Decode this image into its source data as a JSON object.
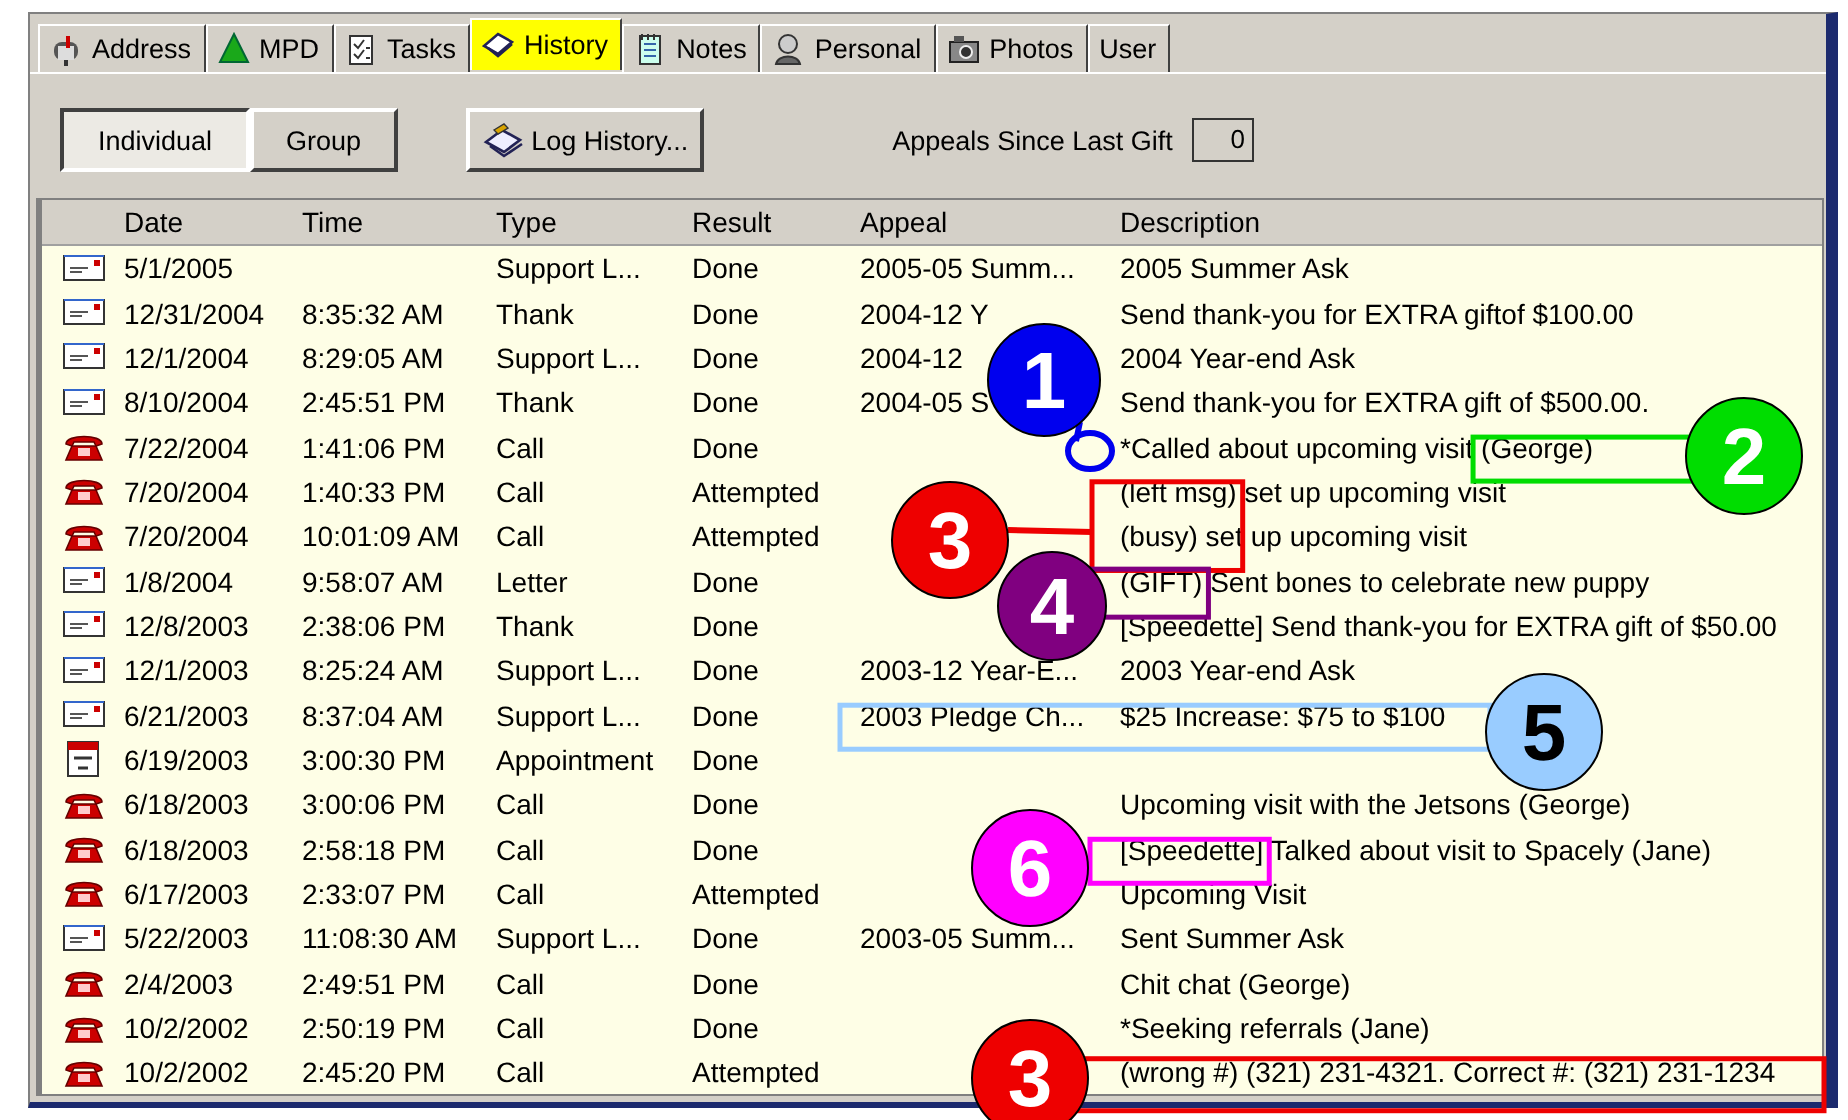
{
  "tabs": [
    {
      "label": "Address",
      "selected": false
    },
    {
      "label": "MPD",
      "selected": false
    },
    {
      "label": "Tasks",
      "selected": false
    },
    {
      "label": "History",
      "selected": true
    },
    {
      "label": "Notes",
      "selected": false
    },
    {
      "label": "Personal",
      "selected": false
    },
    {
      "label": "Photos",
      "selected": false
    },
    {
      "label": "User",
      "selected": false
    }
  ],
  "view_toggle": [
    {
      "label": "Individual",
      "selected": true
    },
    {
      "label": "Group",
      "selected": false
    }
  ],
  "log_button": {
    "label": "Log History..."
  },
  "appeals_since_last_gift": {
    "label": "Appeals Since Last Gift",
    "value": "0"
  },
  "table": {
    "columns": [
      "Date",
      "Time",
      "Type",
      "Result",
      "Appeal",
      "Description"
    ],
    "rows": [
      {
        "kind": "letter",
        "cells": [
          "5/1/2005",
          "",
          "Support L...",
          "Done",
          "2005-05 Summ...",
          "2005 Summer Ask"
        ]
      },
      {
        "kind": "letter",
        "cells": [
          "12/31/2004",
          "8:35:32 AM",
          "Thank",
          "Done",
          "2004-12 Y",
          "Send thank-you for EXTRA giftof $100.00"
        ]
      },
      {
        "kind": "letter",
        "cells": [
          "12/1/2004",
          "8:29:05 AM",
          "Support L...",
          "Done",
          "2004-12",
          "2004 Year-end Ask"
        ]
      },
      {
        "kind": "letter",
        "cells": [
          "8/10/2004",
          "2:45:51 PM",
          "Thank",
          "Done",
          "2004-05 S",
          "Send thank-you for EXTRA gift of $500.00."
        ]
      },
      {
        "kind": "call",
        "cells": [
          "7/22/2004",
          "1:41:06 PM",
          "Call",
          "Done",
          "",
          "*Called about upcoming visit (George)"
        ]
      },
      {
        "kind": "call",
        "cells": [
          "7/20/2004",
          "1:40:33 PM",
          "Call",
          "Attempted",
          "",
          "(left msg) set up upcoming visit"
        ]
      },
      {
        "kind": "call",
        "cells": [
          "7/20/2004",
          "10:01:09 AM",
          "Call",
          "Attempted",
          "",
          "(busy) set up upcoming visit"
        ]
      },
      {
        "kind": "letter",
        "cells": [
          "1/8/2004",
          "9:58:07 AM",
          "Letter",
          "Done",
          "",
          "(GIFT) Sent bones to celebrate new puppy"
        ]
      },
      {
        "kind": "letter",
        "cells": [
          "12/8/2003",
          "2:38:06 PM",
          "Thank",
          "Done",
          "",
          "[Speedette] Send thank-you for EXTRA gift of $50.00"
        ]
      },
      {
        "kind": "letter",
        "cells": [
          "12/1/2003",
          "8:25:24 AM",
          "Support L...",
          "Done",
          "2003-12 Year-E...",
          "2003 Year-end Ask"
        ]
      },
      {
        "kind": "letter",
        "cells": [
          "6/21/2003",
          "8:37:04 AM",
          "Support L...",
          "Done",
          "2003 Pledge Ch...",
          "$25 Increase: $75 to $100"
        ]
      },
      {
        "kind": "appointment",
        "cells": [
          "6/19/2003",
          "3:00:30 PM",
          "Appointment",
          "Done",
          "",
          ""
        ]
      },
      {
        "kind": "call",
        "cells": [
          "6/18/2003",
          "3:00:06 PM",
          "Call",
          "Done",
          "",
          "Upcoming visit with the Jetsons (George)"
        ]
      },
      {
        "kind": "call",
        "cells": [
          "6/18/2003",
          "2:58:18 PM",
          "Call",
          "Done",
          "",
          "[Speedette] Talked about visit to Spacely (Jane)"
        ]
      },
      {
        "kind": "call",
        "cells": [
          "6/17/2003",
          "2:33:07 PM",
          "Call",
          "Attempted",
          "",
          "Upcoming Visit"
        ]
      },
      {
        "kind": "letter",
        "cells": [
          "5/22/2003",
          "11:08:30 AM",
          "Support L...",
          "Done",
          "2003-05 Summ...",
          "Sent Summer Ask"
        ]
      },
      {
        "kind": "call",
        "cells": [
          "2/4/2003",
          "2:49:51 PM",
          "Call",
          "Done",
          "",
          "Chit chat (George)"
        ]
      },
      {
        "kind": "call",
        "cells": [
          "10/2/2002",
          "2:50:19 PM",
          "Call",
          "Done",
          "",
          "*Seeking referrals (Jane)"
        ]
      },
      {
        "kind": "call",
        "cells": [
          "10/2/2002",
          "2:45:20 PM",
          "Call",
          "Attempted",
          "",
          "(wrong #) (321) 231-4321. Correct #: (321) 231-1234"
        ]
      }
    ]
  },
  "callouts": [
    {
      "label": "1",
      "color": "#0000ee"
    },
    {
      "label": "2",
      "color": "#00dd00"
    },
    {
      "label": "3",
      "color": "#ee0000"
    },
    {
      "label": "4",
      "color": "#800080"
    },
    {
      "label": "5",
      "color": "#99ccff"
    },
    {
      "label": "6",
      "color": "#ff00ff"
    },
    {
      "label": "3",
      "color": "#ee0000"
    }
  ]
}
